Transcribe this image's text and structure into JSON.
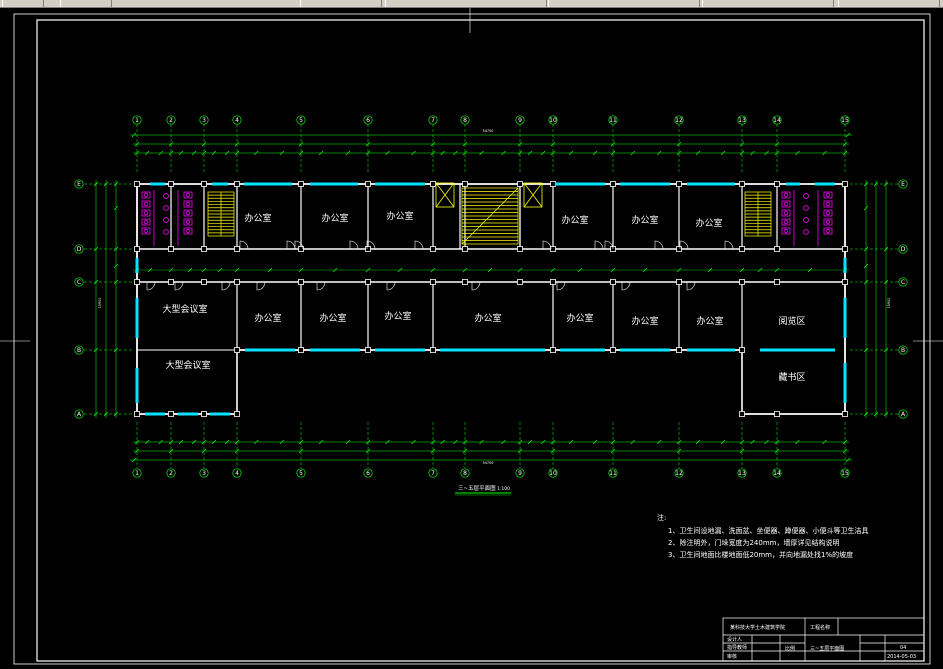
{
  "drawing": {
    "plan_title": "三~五层平面图",
    "plan_scale": "1:100",
    "top_total_dim": "54700",
    "bottom_total_dim": "54700",
    "left_total_dim": "15900",
    "right_total_dim": "15900",
    "axes_top": [
      "1",
      "2",
      "3",
      "4",
      "5",
      "6",
      "7",
      "8",
      "9",
      "10",
      "11",
      "12",
      "13",
      "14",
      "15"
    ],
    "axes_side": [
      "E",
      "D",
      "C",
      "B",
      "A"
    ],
    "rooms": {
      "office1": "办公室",
      "office2": "办公室",
      "office3": "办公室",
      "office4": "办公室",
      "office5": "办公室",
      "office6": "办公室",
      "office7": "办公室",
      "office8": "办公室",
      "office9": "办公室",
      "office10": "办公室",
      "office11": "办公室",
      "office12": "办公室",
      "meeting1": "大型会议室",
      "meeting2": "大型会议室",
      "reading": "阅览区",
      "books": "藏书区"
    },
    "notes": {
      "heading": "注:",
      "line1": "1、卫生间设地漏、洗面盆、坐便器、蹲便器、小便斗等卫生洁具",
      "line2": "2、除注明外，门垛宽度为240mm，墙厚详见结构说明",
      "line3": "3、卫生间地面比楼地面低20mm，并向地漏处找1%的坡度"
    },
    "title_block": {
      "school": "某科技大学土木建筑学院",
      "project": "工程名称",
      "drawing_name": "三~五层平面图",
      "role1": "设计人",
      "role2": "指导教师",
      "role3": "审核",
      "scale_label": "比例",
      "sheet": "04",
      "date": "2014-05-03"
    }
  },
  "colors": {
    "frame": "#ffffff",
    "wall": "#ffffff",
    "window": "#00e5ff",
    "axis": "#00ff00",
    "dim": "#00ff00",
    "stair": "#ffff00",
    "fixture": "#ff00ff",
    "toolbar": "#d4d0c8"
  }
}
